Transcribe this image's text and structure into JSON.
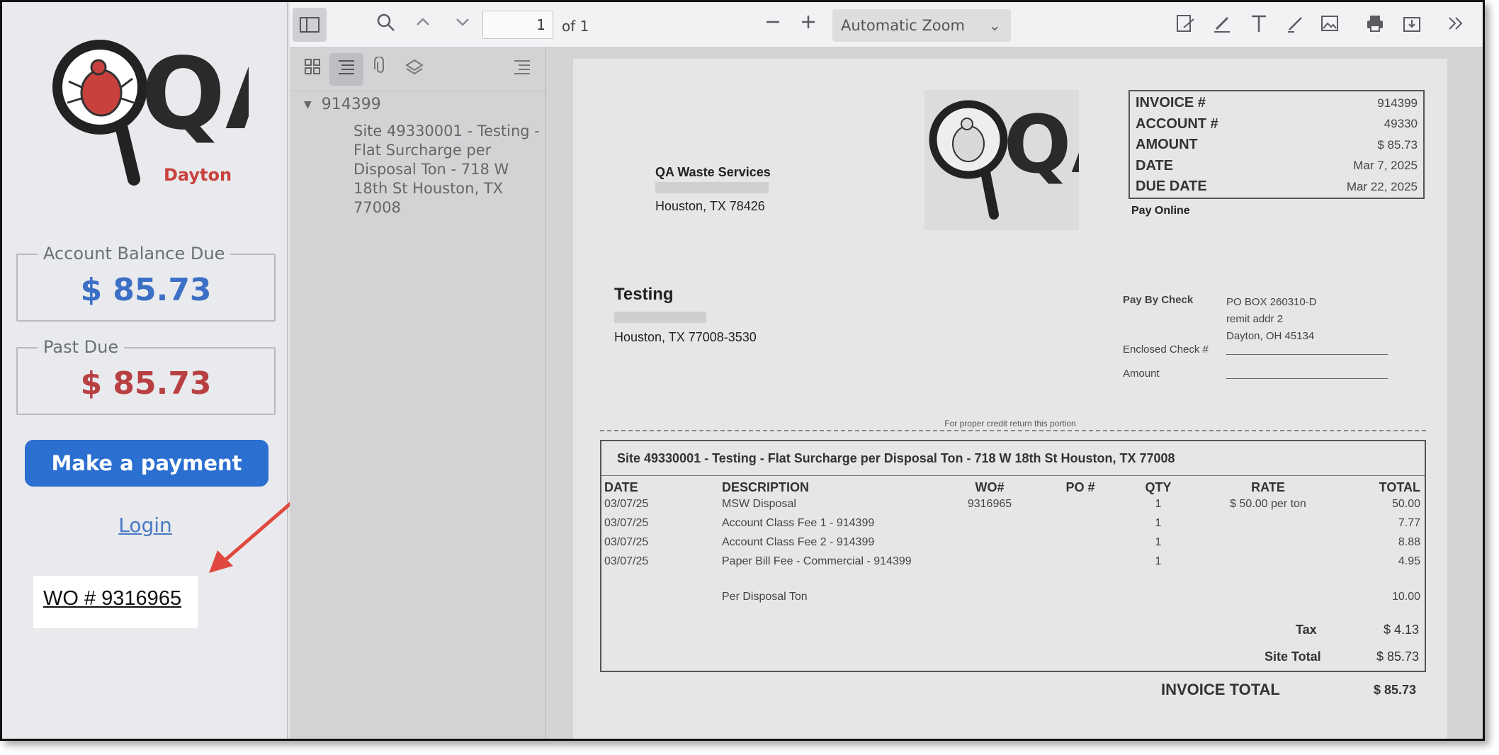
{
  "portal": {
    "logo_text": "QA",
    "logo_city": "Dayton",
    "balance_label": "Account Balance Due",
    "balance_value": "$ 85.73",
    "pastdue_label": "Past Due",
    "pastdue_value": "$ 85.73",
    "pay_button": "Make a payment",
    "login_link": "Login",
    "wo_callout": "WO # 9316965"
  },
  "toolbar": {
    "page_value": "1",
    "page_of": "of 1",
    "zoom": "Automatic Zoom"
  },
  "outline": {
    "root": "914399",
    "child": "Site 49330001 - Testing - Flat Surcharge per Disposal Ton - 718 W 18th St Houston, TX 77008"
  },
  "invoice": {
    "logo_text": "QA",
    "sender": {
      "name": "QA Waste Services",
      "city": "Houston, TX 78426"
    },
    "summary": [
      {
        "k": "INVOICE #",
        "v": "914399"
      },
      {
        "k": "ACCOUNT #",
        "v": "49330"
      },
      {
        "k": "AMOUNT",
        "v": "$ 85.73"
      },
      {
        "k": "DATE",
        "v": "Mar 7, 2025"
      },
      {
        "k": "DUE DATE",
        "v": "Mar 22, 2025"
      }
    ],
    "pay_online": "Pay Online",
    "recipient": {
      "name": "Testing",
      "city": "Houston, TX 77008-3530"
    },
    "pay_by_check": {
      "label": "Pay By Check",
      "addr1": "PO BOX 260310-D",
      "addr2": "remit addr 2",
      "addr3": "Dayton, OH 45134",
      "enclosed_label": "Enclosed Check #",
      "amount_label": "Amount"
    },
    "tear_note": "For proper credit return this portion",
    "site_title": "Site 49330001 - Testing - Flat Surcharge per Disposal Ton - 718 W 18th St Houston, TX 77008",
    "columns": [
      "DATE",
      "DESCRIPTION",
      "WO#",
      "PO #",
      "QTY",
      "RATE",
      "TOTAL"
    ],
    "lines": [
      {
        "date": "03/07/25",
        "desc": "MSW Disposal",
        "wo": "9316965",
        "po": "",
        "qty": "1",
        "rate": "$ 50.00 per ton",
        "total": "50.00"
      },
      {
        "date": "03/07/25",
        "desc": "Account Class Fee 1 - 914399",
        "wo": "",
        "po": "",
        "qty": "1",
        "rate": "",
        "total": "7.77"
      },
      {
        "date": "03/07/25",
        "desc": "Account Class Fee 2 - 914399",
        "wo": "",
        "po": "",
        "qty": "1",
        "rate": "",
        "total": "8.88"
      },
      {
        "date": "03/07/25",
        "desc": "Paper Bill Fee - Commercial - 914399",
        "wo": "",
        "po": "",
        "qty": "1",
        "rate": "",
        "total": "4.95"
      },
      {
        "date": "",
        "desc": "Per Disposal Ton",
        "wo": "",
        "po": "",
        "qty": "",
        "rate": "",
        "total": "10.00"
      }
    ],
    "tax_label": "Tax",
    "tax_value": "$ 4.13",
    "site_total_label": "Site Total",
    "site_total_value": "$ 85.73",
    "invoice_total_label": "INVOICE TOTAL",
    "invoice_total_value": "$ 85.73"
  },
  "colors": {
    "accent": "#2b6fd0",
    "balance": "#3c6fc6",
    "past_due": "#b84042",
    "logo_red": "#c9413d",
    "arrow": "#e0483f"
  }
}
